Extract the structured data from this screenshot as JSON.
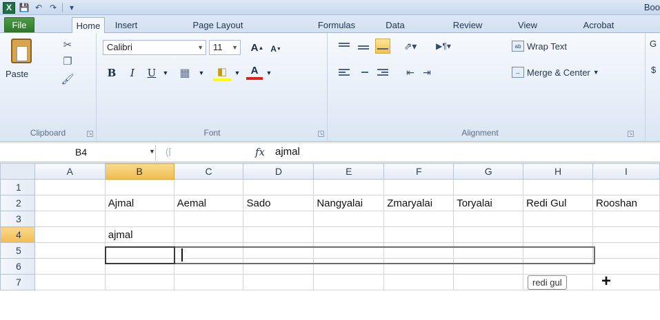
{
  "window": {
    "title_fragment": "Boo"
  },
  "quick_access": {
    "app_icon": "excel-icon",
    "items": [
      "save-icon",
      "undo-icon",
      "redo-icon",
      "customize-icon"
    ]
  },
  "tabs": [
    {
      "label": "File"
    },
    {
      "label": "Home",
      "active": true
    },
    {
      "label": "Insert"
    },
    {
      "label": "Page Layout"
    },
    {
      "label": "Formulas"
    },
    {
      "label": "Data"
    },
    {
      "label": "Review"
    },
    {
      "label": "View"
    },
    {
      "label": "Acrobat"
    }
  ],
  "ribbon": {
    "clipboard": {
      "label": "Clipboard",
      "paste_label": "Paste",
      "icons": [
        "cut-icon",
        "copy-icon",
        "format-painter-icon"
      ]
    },
    "font": {
      "label": "Font",
      "font_name": "Calibri",
      "font_size": "11",
      "grow_label": "A",
      "shrink_label": "A",
      "bold": "B",
      "italic": "I",
      "underline": "U",
      "font_color": "A"
    },
    "alignment": {
      "label": "Alignment",
      "wrap_text": "Wrap Text",
      "merge_center": "Merge & Center",
      "cut_off_group_letter_top": "G",
      "cut_off_group_letter_bottom": "$"
    }
  },
  "formula_bar": {
    "name_box": "B4",
    "fx_symbol": "fx",
    "formula": "ajmal"
  },
  "sheet": {
    "column_headers": [
      "A",
      "B",
      "C",
      "D",
      "E",
      "F",
      "G",
      "H",
      "I"
    ],
    "selected_column": "B",
    "row_numbers": [
      "1",
      "2",
      "3",
      "4",
      "5",
      "6",
      "7"
    ],
    "selected_row": "4",
    "rows": [
      [
        "",
        "",
        "",
        "",
        "",
        "",
        "",
        "",
        ""
      ],
      [
        "",
        "Ajmal",
        "Aemal",
        "Sado",
        "Nangyalai",
        "Zmaryalai",
        "Toryalai",
        "Redi Gul",
        "Rooshan"
      ],
      [
        "",
        "",
        "",
        "",
        "",
        "",
        "",
        "",
        ""
      ],
      [
        "",
        "ajmal",
        "",
        "",
        "",
        "",
        "",
        "",
        ""
      ],
      [
        "",
        "",
        "",
        "",
        "",
        "",
        "",
        "",
        ""
      ],
      [
        "",
        "",
        "",
        "",
        "",
        "",
        "",
        "",
        ""
      ],
      [
        "",
        "",
        "",
        "",
        "",
        "",
        "",
        "",
        ""
      ]
    ]
  },
  "autocomplete_tip": "redi gul",
  "colors": {
    "file_tab": "#2f7a2a",
    "selection_header": "#f1bd4f",
    "ribbon_bg": "#dbe6f4"
  }
}
